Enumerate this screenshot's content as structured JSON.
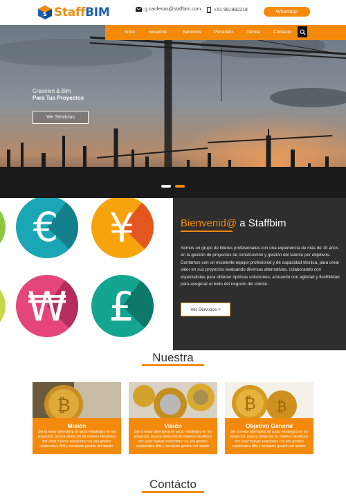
{
  "header": {
    "logo_text_staff": "Staff",
    "logo_text_bim": "BIM",
    "email": "g.cardenas@staffbim.com",
    "phone": "+51 991982218",
    "whatsapp_label": "Whatsapp"
  },
  "nav": {
    "items": [
      "Inicio",
      "Nosotros",
      "Servicios",
      "Portafolio",
      "Tienda",
      "Contácto"
    ]
  },
  "hero": {
    "title_line1": "Creacion & Bim",
    "title_line2": "Para Tus Proyectos",
    "button_label": "Ver Servicios",
    "slides": 2,
    "active_slide": 1
  },
  "currencies": {
    "symbols": [
      "€",
      "¥",
      "₩",
      "£"
    ],
    "colors": [
      "#1aa6b5",
      "#f7a30c",
      "#e4457a",
      "#13a58f"
    ]
  },
  "welcome": {
    "title_highlight": "Bienvenid@",
    "title_rest": " a Staffbim",
    "body": "Somos un grupo de lideres profesionales con una experiencia de más de 10 años en la gestión de proyectos de construcción y gestión del talento por objetivos. Contamos con un excelente equipo profesional y de capacidad técnica, para crear valor en sus proyectos evaluando diversas alternativas, colaborando con especialistas para obtener óptimas soluciones, actuando con agilidad y flexibilidad para asegurar el éxito del negocio del cliente.",
    "button_label": "Ver Servicios >"
  },
  "nuestra": {
    "title": "Nuestra",
    "cards": [
      {
        "title": "Misión",
        "text": "Ser la mejor alternativa de socio estratégico en los proyectos, para la obtención de mejores beneficios por crear nuevas soluciones con una gestión colaborativa BIM y excelente gestión del talento."
      },
      {
        "title": "Visión",
        "text": "Ser la mejor alternativa de socio estratégico en los proyectos, para la obtención de mejores beneficios por crear nuevas soluciones con una gestión colaborativa BIM y excelente gestión del talento."
      },
      {
        "title": "Objetivo General",
        "text": "Ser la mejor alternativa de socio estratégico en los proyectos, para la obtención de mejores beneficios por crear nuevas soluciones con una gestión colaborativa BIM y excelente gestión del talento."
      }
    ]
  },
  "contacto": {
    "title": "Contácto"
  },
  "colors": {
    "accent": "#f48a0c",
    "dark_panel": "#2e2e2e",
    "logo_blue": "#1f5fae"
  }
}
